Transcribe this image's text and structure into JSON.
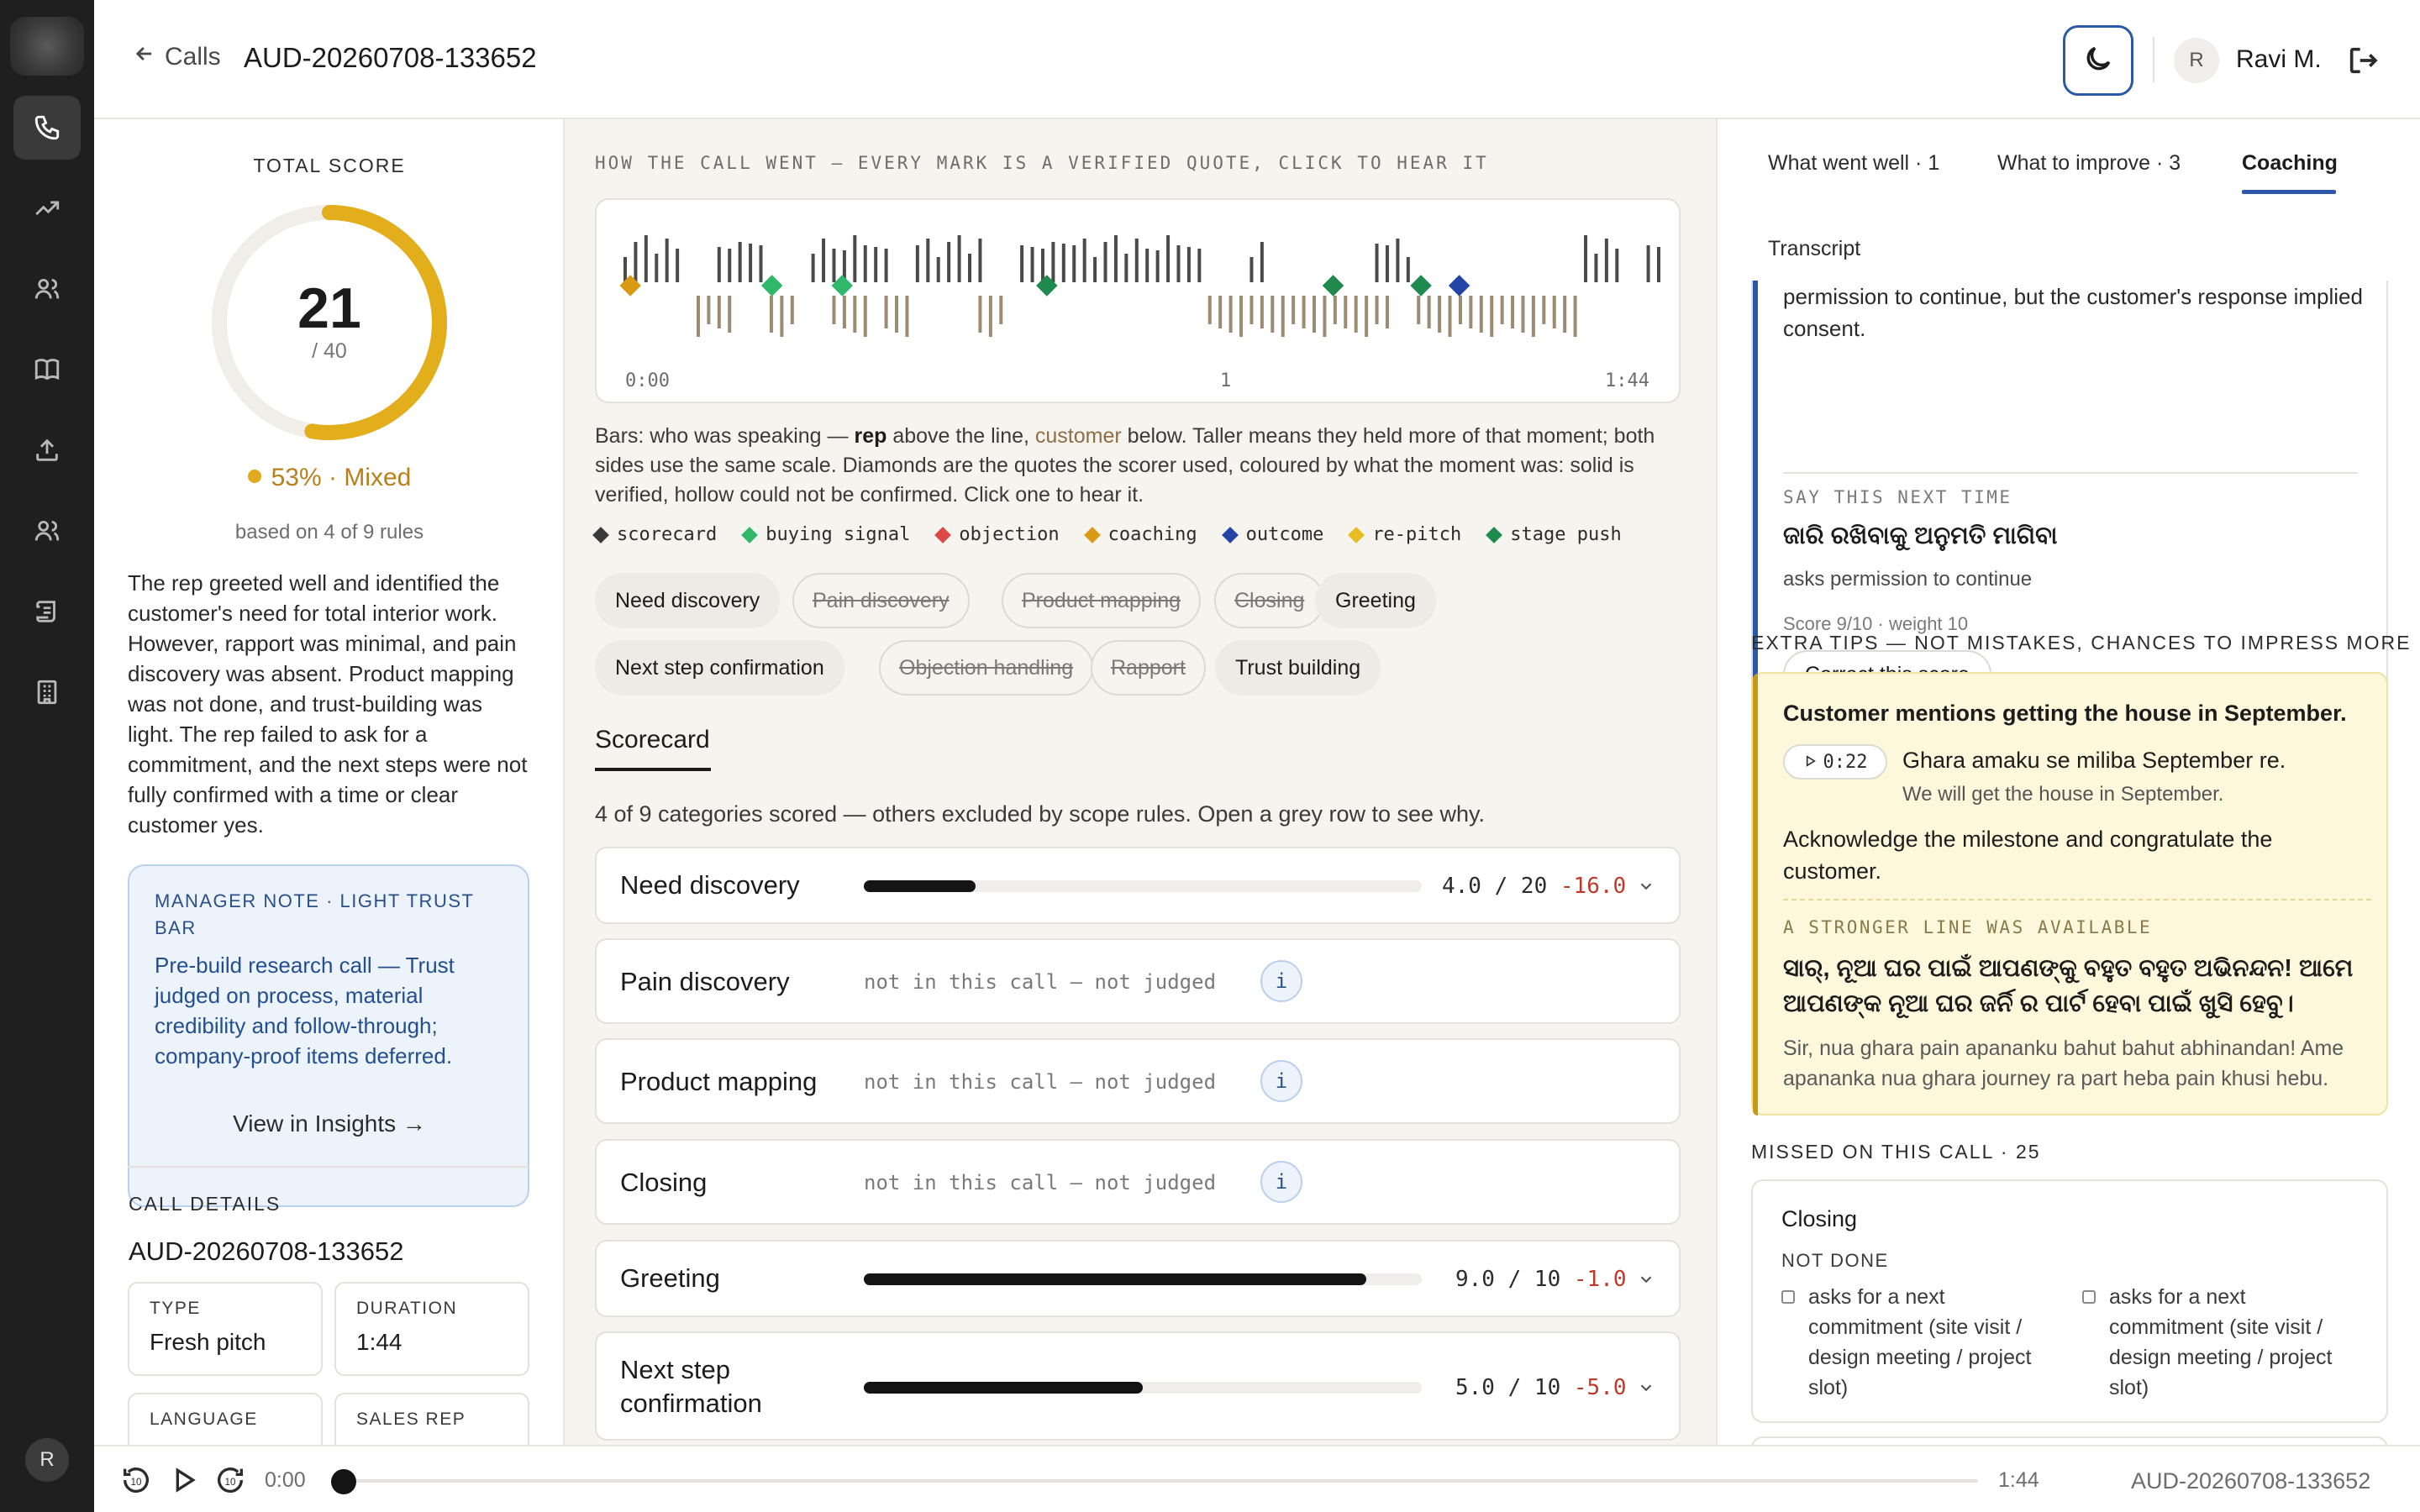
{
  "header": {
    "back_label": "Calls",
    "call_id": "AUD-20260708-133652",
    "user_initial": "R",
    "user_name": "Ravi M."
  },
  "rail": {
    "user_initial": "R"
  },
  "summary": {
    "total_score_label": "TOTAL SCORE",
    "score": "21",
    "score_max": "/ 40",
    "score_fraction": 0.525,
    "verdict": "53% · Mixed",
    "based_on": "based on 4 of 9 rules",
    "narrative": "The rep greeted well and identified the customer's need for total interior work. However, rapport was minimal, and pain discovery was absent. Product mapping was not done, and trust-building was light. The rep failed to ask for a commitment, and the next steps were not fully confirmed with a time or clear customer yes.",
    "manager_note_header": "MANAGER NOTE · LIGHT TRUST BAR",
    "manager_note_body": "Pre-build research call — Trust judged on process, material credibility and follow-through; company-proof items deferred.",
    "insights_link": "View in Insights →",
    "call_details_label": "CALL DETAILS",
    "call_details_id": "AUD-20260708-133652",
    "details": [
      {
        "key": "TYPE",
        "value": "Fresh pitch"
      },
      {
        "key": "DURATION",
        "value": "1:44"
      },
      {
        "key": "LANGUAGE",
        "value": ""
      },
      {
        "key": "SALES REP",
        "value": ""
      }
    ],
    "colors": {
      "ring": "#e3ae1c",
      "ring_track": "#f1eee9",
      "note_bg": "#edf3fb"
    }
  },
  "timeline": {
    "caption": "HOW THE CALL WENT — EVERY MARK IS A VERIFIED QUOTE, CLICK TO HEAR IT",
    "axis_labels": [
      "0:00",
      "1",
      "1:44"
    ],
    "explanation": {
      "p1": "Bars: who was speaking — ",
      "rep": "rep",
      "p2": " above the line, ",
      "customer": "customer",
      "p3": " below. Taller means they held more of that moment; both sides use the same scale. Diamonds are the quotes the scorer used, coloured by what the moment was: solid is verified, hollow could not be confirmed. Click one to hear it."
    },
    "legend": [
      {
        "label": "scorecard",
        "color": "#3a3a3a"
      },
      {
        "label": "buying signal",
        "color": "#2fb86a"
      },
      {
        "label": "objection",
        "color": "#e04848"
      },
      {
        "label": "coaching",
        "color": "#d99a15"
      },
      {
        "label": "outcome",
        "color": "#2544a8"
      },
      {
        "label": "re-pitch",
        "color": "#e8bd22"
      },
      {
        "label": "stage push",
        "color": "#1f8a4d"
      }
    ],
    "diamonds": [
      {
        "t": 0.005,
        "type": "coaching"
      },
      {
        "t": 0.142,
        "type": "buying signal"
      },
      {
        "t": 0.21,
        "type": "buying signal"
      },
      {
        "t": 0.408,
        "type": "stage push"
      },
      {
        "t": 0.685,
        "type": "stage push"
      },
      {
        "t": 0.77,
        "type": "stage push"
      },
      {
        "t": 0.807,
        "type": "outcome"
      }
    ]
  },
  "filters": [
    {
      "label": "Need discovery",
      "active": true
    },
    {
      "label": "Pain discovery",
      "active": false
    },
    {
      "label": "Product mapping",
      "active": false
    },
    {
      "label": "Closing",
      "active": false
    },
    {
      "label": "Greeting",
      "active": true
    },
    {
      "label": "Next step confirmation",
      "active": true
    },
    {
      "label": "Objection handling",
      "active": false
    },
    {
      "label": "Rapport",
      "active": false
    },
    {
      "label": "Trust building",
      "active": true
    }
  ],
  "scorecard": {
    "tab_label": "Scorecard",
    "note": "4 of 9 categories scored — others excluded by scope rules. Open a grey row to see why.",
    "rows": [
      {
        "name": "Need discovery",
        "score": "4.0 / 20",
        "delta": "-16.0",
        "fraction": 0.2
      },
      {
        "name": "Pain discovery",
        "status": "not in this call — not judged",
        "info": "i"
      },
      {
        "name": "Product mapping",
        "status": "not in this call — not judged",
        "info": "i"
      },
      {
        "name": "Closing",
        "status": "not in this call — not judged",
        "info": "i"
      },
      {
        "name": "Greeting",
        "score": "9.0 / 10",
        "delta": "-1.0",
        "fraction": 0.9
      },
      {
        "name": "Next step confirmation",
        "score": "5.0 / 10",
        "delta": "-5.0",
        "fraction": 0.5
      }
    ]
  },
  "right": {
    "tabs": [
      "What went well · 1",
      "What to improve · 3",
      "Coaching"
    ],
    "active_tab": "Coaching",
    "transcript_label": "Transcript",
    "coach_card": {
      "text": "permission to continue, but the customer's response implied consent.",
      "say_label": "SAY THIS NEXT TIME",
      "odia": "ଜାରି ରଖିବାକୁ ଅନୁମତି ମାଗିବା",
      "translation": "asks permission to continue",
      "score_weight": "Score 9/10 · weight 10",
      "button": "Correct this score"
    },
    "extra_tips_label": "EXTRA TIPS — NOT MISTAKES, CHANCES TO IMPRESS MORE",
    "tip": {
      "headline": "Customer mentions getting the house in September.",
      "timestamp": "0:22",
      "quote": "Ghara amaku se miliba September re.",
      "quote_translation": "We will get the house in September.",
      "advice": "Acknowledge the milestone and congratulate the customer.",
      "stronger_label": "A STRONGER LINE WAS AVAILABLE",
      "stronger_odia": "ସାର୍, ନୂଆ ଘର ପାଇଁ ଆପଣଙ୍କୁ ବହୁତ ବହୁତ ଅଭିନନ୍ଦନ! ଆମେ ଆପଣଙ୍କ ନୂଆ ଘର ଜର୍ନି ର ପାର୍ଟ ହେବା ପାଇଁ ଖୁସି ହେବୁ।",
      "stronger_roman": "Sir, nua ghara pain apananku bahut bahut abhinandan! Ame apananka nua ghara journey ra part heba pain khusi hebu."
    },
    "missed_label": "MISSED ON THIS CALL · 25",
    "missed": {
      "title": "Closing",
      "status": "NOT DONE",
      "items": [
        "asks for a next commitment (site visit / design meeting / project slot)",
        "asks for a next commitment (site visit / design meeting / project slot)"
      ]
    }
  },
  "player": {
    "current": "0:00",
    "duration": "1:44",
    "call_id": "AUD-20260708-133652"
  }
}
